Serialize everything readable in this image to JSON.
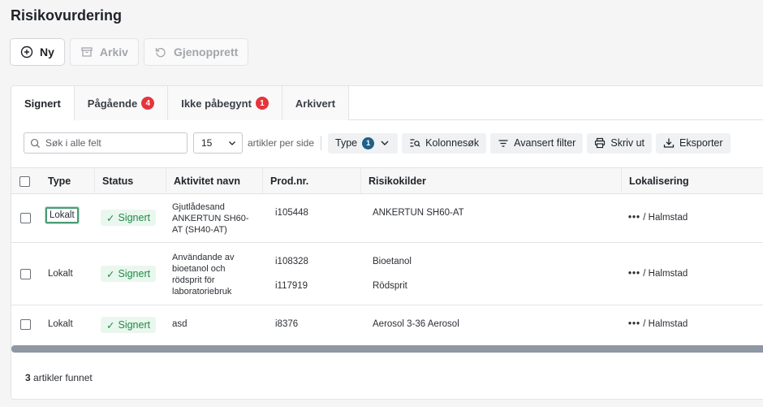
{
  "page": {
    "title": "Risikovurdering"
  },
  "actions": {
    "new": "Ny",
    "archive": "Arkiv",
    "restore": "Gjenopprett"
  },
  "tabs": [
    {
      "label": "Signert",
      "badge": ""
    },
    {
      "label": "Pågående",
      "badge": "4"
    },
    {
      "label": "Ikke påbegynt",
      "badge": "1"
    },
    {
      "label": "Arkivert",
      "badge": ""
    }
  ],
  "toolbar": {
    "search_placeholder": "Søk i alle felt",
    "per_page_value": "15",
    "per_page_label": "artikler per side",
    "type_label": "Type",
    "type_badge": "1",
    "column_search": "Kolonnesøk",
    "advanced_filter": "Avansert filter",
    "print": "Skriv ut",
    "export": "Eksporter"
  },
  "table": {
    "headers": {
      "type": "Type",
      "status": "Status",
      "activity": "Aktivitet navn",
      "prod": "Prod.nr.",
      "risk": "Risikokilder",
      "location": "Lokalisering"
    },
    "rows": [
      {
        "type": "Lokalt",
        "status": "Signert",
        "activity": [
          "Gjutlådesand",
          "ANKERTUN SH60-",
          "AT (SH40-AT)"
        ],
        "prod": [
          "i105448"
        ],
        "risk": [
          "ANKERTUN SH60-AT"
        ],
        "location_dots": "•••",
        "location": "/ Halmstad"
      },
      {
        "type": "Lokalt",
        "status": "Signert",
        "activity": [
          "Användande av",
          "bioetanol och",
          "rödsprit för",
          "laboratoriebruk"
        ],
        "prod": [
          "i108328",
          "i117919"
        ],
        "risk": [
          "Bioetanol",
          "Rödsprit"
        ],
        "location_dots": "•••",
        "location": "/ Halmstad"
      },
      {
        "type": "Lokalt",
        "status": "Signert",
        "activity": [
          "asd"
        ],
        "prod": [
          "i8376"
        ],
        "risk": [
          "Aerosol 3-36 Aerosol"
        ],
        "location_dots": "•••",
        "location": "/ Halmstad"
      }
    ]
  },
  "footer": {
    "count": "3",
    "label": "artikler funnet"
  }
}
